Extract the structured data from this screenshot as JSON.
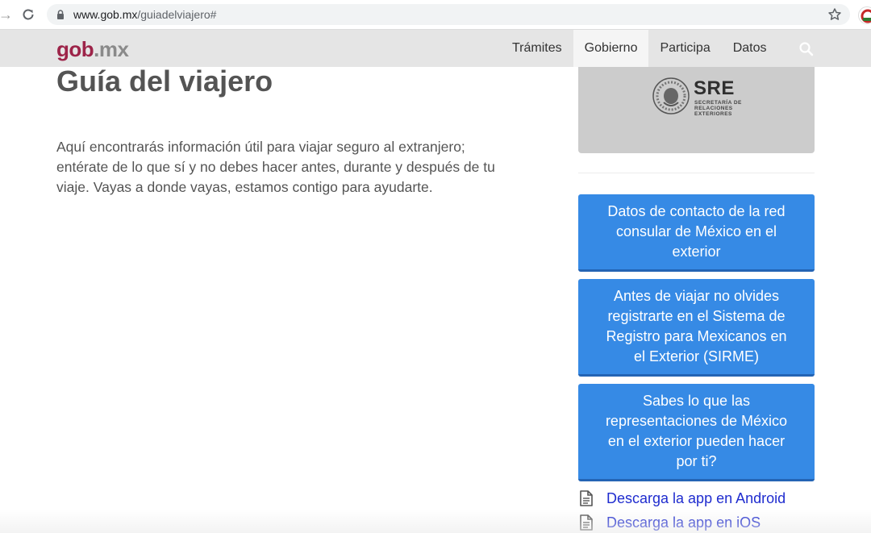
{
  "browser": {
    "url_domain": "www.gob.mx",
    "url_path": "/guiadelviajero#"
  },
  "header": {
    "logo_main": "gob",
    "logo_suffix": ".mx",
    "menu": [
      {
        "label": "Trámites"
      },
      {
        "label": "Gobierno"
      },
      {
        "label": "Participa"
      },
      {
        "label": "Datos"
      }
    ],
    "active_menu": "Gobierno"
  },
  "main": {
    "title": "Guía del viajero",
    "intro": "Aquí encontrarás información útil para viajar seguro al extranjero; entérate de lo que sí y no debes hacer antes, durante y después de tu viaje. Vayas a donde vayas, estamos contigo para ayudarte."
  },
  "sidebar": {
    "sre_title": "SRE",
    "sre_subtitle": "SECRETARÍA DE RELACIONES EXTERIORES",
    "buttons": [
      {
        "label": "Datos de contacto de la red consular de México en el exterior"
      },
      {
        "label": "Antes de viajar no olvides registrarte en el Sistema de Registro para Mexicanos en el Exterior (SIRME)"
      },
      {
        "label": "Sabes lo que las representaciones de México en el exterior pueden hacer por ti?"
      }
    ],
    "downloads": [
      {
        "label": "Descarga la app en Android"
      },
      {
        "label": "Descarga la app en iOS"
      }
    ]
  },
  "colors": {
    "brand": "#9d2449",
    "button_blue": "#368ae5",
    "link_blue": "#1f2ccf",
    "header_bg": "#e5e5e5"
  }
}
